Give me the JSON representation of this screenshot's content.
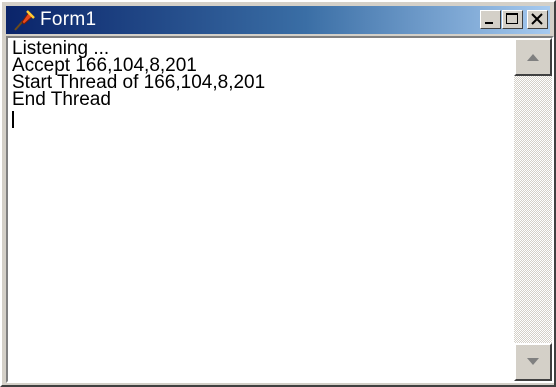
{
  "window": {
    "title": "Form1",
    "app_icon": "pin-icon",
    "caption_buttons": [
      "minimize-icon",
      "maximize-icon",
      "close-icon"
    ],
    "colors": {
      "title_start": "#0a246a",
      "title_end": "#a6caf0",
      "face": "#d4d0c8"
    }
  },
  "textarea": {
    "lines": [
      "Listening ...",
      "Accept 166,104,8,201",
      "Start Thread of 166,104,8,201",
      "End Thread"
    ]
  },
  "scrollbar": {
    "up_icon": "arrow-up-icon",
    "down_icon": "arrow-down-icon"
  }
}
